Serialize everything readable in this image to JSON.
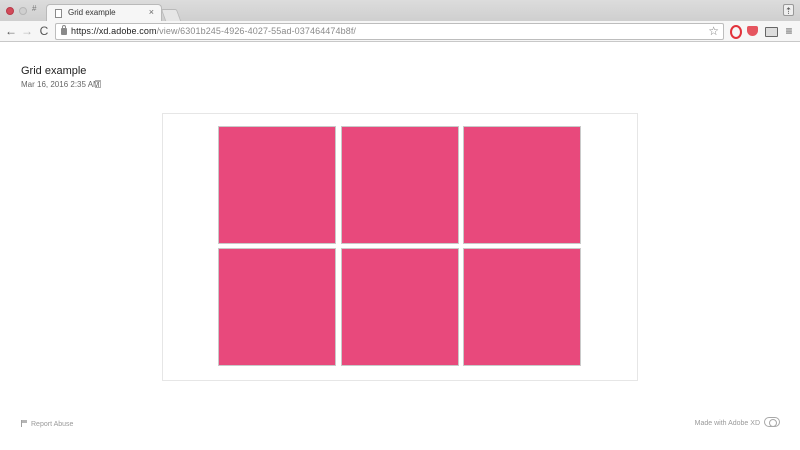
{
  "browser": {
    "tab_title": "Grid example",
    "tab_close": "×",
    "url_host": "https://xd.adobe.com",
    "url_path": "/view/6301b245-4926-4027-55ad-037464474b8f/",
    "back_glyph": "←",
    "forward_glyph": "→",
    "reload_glyph": "C",
    "star_glyph": "☆",
    "menu_glyph": "≡",
    "profile_glyph": "⇡",
    "max_glyph": "#"
  },
  "document": {
    "title": "Grid example",
    "date": "Mar 16, 2016 2:35 AM"
  },
  "artboard": {
    "cell_color": "#e8497c",
    "rows": 2,
    "columns": 3
  },
  "footer": {
    "report_label": "Report Abuse",
    "made_with": "Made with Adobe XD"
  }
}
